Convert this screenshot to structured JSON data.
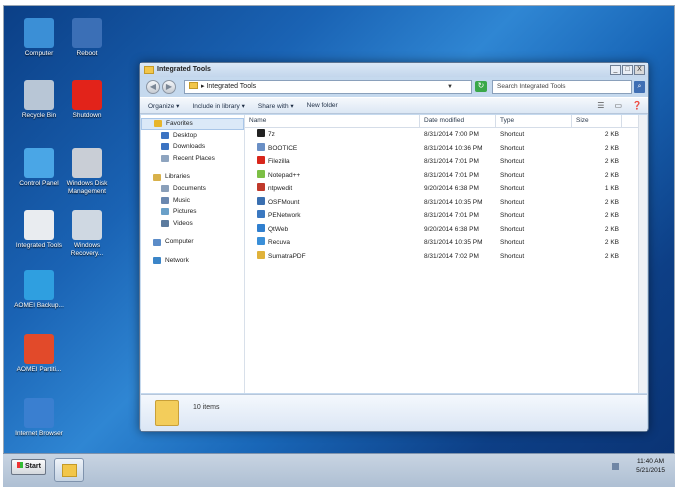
{
  "desktop": {
    "icons": [
      {
        "label": "Computer",
        "color": "#3b8fd6"
      },
      {
        "label": "Reboot",
        "color": "#3b6fb6"
      },
      {
        "label": "Recycle Bin",
        "color": "#b8c6d6"
      },
      {
        "label": "Shutdown",
        "color": "#e2231a"
      },
      {
        "label": "Control Panel",
        "color": "#4aa6e6"
      },
      {
        "label": "Windows Disk Management",
        "color": "#c9ced6"
      },
      {
        "label": "Integrated Tools",
        "color": "#e9ecf0"
      },
      {
        "label": "Windows Recovery...",
        "color": "#cfd8e2"
      },
      {
        "label": "AOMEI Backup...",
        "color": "#2f9fe0"
      },
      {
        "label": "AOMEI Partiti...",
        "color": "#e24a2a"
      },
      {
        "label": "Internet Browser",
        "color": "#3a7fd0"
      }
    ]
  },
  "window": {
    "title": "Integrated Tools",
    "min_label": "_",
    "max_label": "□",
    "close_label": "X",
    "address": {
      "path": "Integrated Tools"
    },
    "search": {
      "placeholder": "Search Integrated Tools"
    },
    "toolbar": {
      "organize": "Organize ▾",
      "include": "Include in library ▾",
      "share": "Share with ▾",
      "newfolder": "New folder"
    },
    "nav_pane": [
      {
        "label": "Favorites",
        "indent": 0,
        "color": "#e7b52b",
        "selected": true
      },
      {
        "label": "Desktop",
        "indent": 1,
        "color": "#3b73c2"
      },
      {
        "label": "Downloads",
        "indent": 1,
        "color": "#3b73c2"
      },
      {
        "label": "Recent Places",
        "indent": 1,
        "color": "#8ea4bf"
      },
      {
        "label": "",
        "indent": 0,
        "spacer": true
      },
      {
        "label": "Libraries",
        "indent": 0,
        "color": "#d8b14a"
      },
      {
        "label": "Documents",
        "indent": 1,
        "color": "#8a9fb9"
      },
      {
        "label": "Music",
        "indent": 1,
        "color": "#6a88b0"
      },
      {
        "label": "Pictures",
        "indent": 1,
        "color": "#6aa0c8"
      },
      {
        "label": "Videos",
        "indent": 1,
        "color": "#5c7b9e"
      },
      {
        "label": "",
        "indent": 0,
        "spacer": true
      },
      {
        "label": "Computer",
        "indent": 0,
        "color": "#5b8cc8"
      },
      {
        "label": "",
        "indent": 0,
        "spacer": true
      },
      {
        "label": "Network",
        "indent": 0,
        "color": "#3b85c8"
      }
    ],
    "columns": [
      "Name",
      "Date modified",
      "Type",
      "Size"
    ],
    "files": [
      {
        "name": "7z",
        "date": "8/31/2014 7:00 PM",
        "type": "Shortcut",
        "size": "2 KB",
        "color": "#222222"
      },
      {
        "name": "BOOTICE",
        "date": "8/31/2014 10:36 PM",
        "type": "Shortcut",
        "size": "2 KB",
        "color": "#6a8fc5"
      },
      {
        "name": "Filezilla",
        "date": "8/31/2014 7:01 PM",
        "type": "Shortcut",
        "size": "2 KB",
        "color": "#d8261b"
      },
      {
        "name": "Notepad++",
        "date": "8/31/2014 7:01 PM",
        "type": "Shortcut",
        "size": "2 KB",
        "color": "#7cbf45"
      },
      {
        "name": "ntpwedit",
        "date": "9/20/2014 6:38 PM",
        "type": "Shortcut",
        "size": "1 KB",
        "color": "#c0392b"
      },
      {
        "name": "OSFMount",
        "date": "8/31/2014 10:35 PM",
        "type": "Shortcut",
        "size": "2 KB",
        "color": "#3a6fb0"
      },
      {
        "name": "PENetwork",
        "date": "8/31/2014 7:01 PM",
        "type": "Shortcut",
        "size": "2 KB",
        "color": "#3a78c0"
      },
      {
        "name": "QtWeb",
        "date": "9/20/2014 6:38 PM",
        "type": "Shortcut",
        "size": "2 KB",
        "color": "#2f7fcf"
      },
      {
        "name": "Recuva",
        "date": "8/31/2014 10:35 PM",
        "type": "Shortcut",
        "size": "2 KB",
        "color": "#3a8fd8"
      },
      {
        "name": "SumatraPDF",
        "date": "8/31/2014 7:02 PM",
        "type": "Shortcut",
        "size": "2 KB",
        "color": "#e0b23a"
      }
    ],
    "status": "10 items"
  },
  "taskbar": {
    "start_label": "Start",
    "time": "11:40 AM",
    "date": "5/21/2015"
  }
}
